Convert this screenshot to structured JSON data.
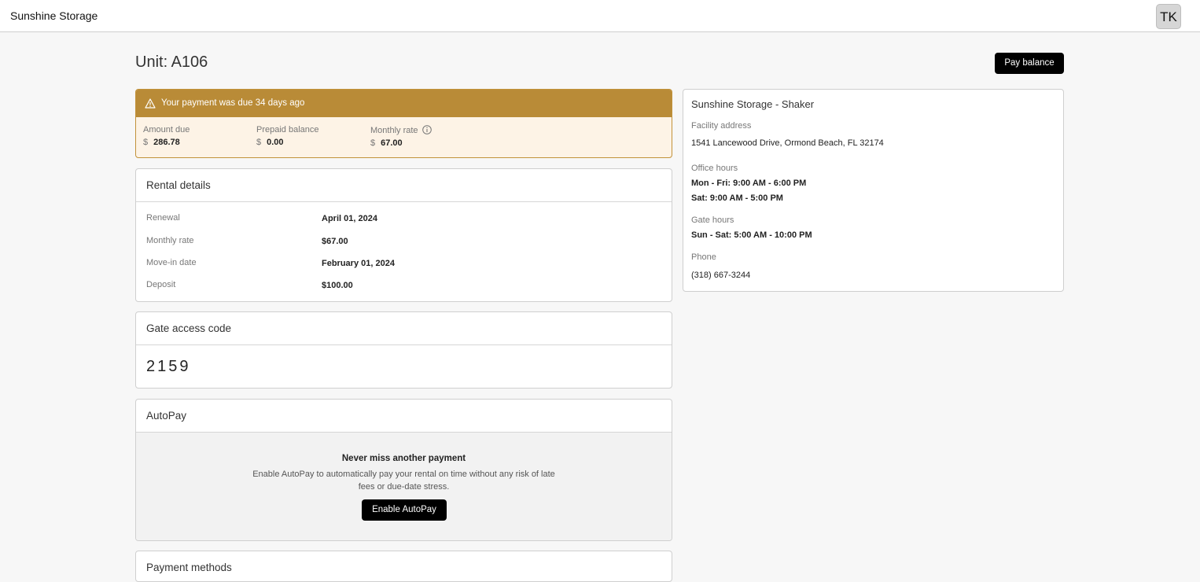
{
  "app": {
    "brand": "Sunshine Storage",
    "user_initials": "TK"
  },
  "page": {
    "title": "Unit: A106",
    "pay_button": "Pay balance"
  },
  "alert": {
    "message": "Your payment was due 34 days ago",
    "stats": [
      {
        "label": "Amount due",
        "currency": "$",
        "value": "286.78"
      },
      {
        "label": "Prepaid balance",
        "currency": "$",
        "value": "0.00"
      },
      {
        "label": "Monthly rate",
        "currency": "$",
        "value": "67.00"
      }
    ]
  },
  "rental": {
    "title": "Rental details",
    "rows": [
      {
        "label": "Renewal",
        "value": "April 01, 2024"
      },
      {
        "label": "Monthly rate",
        "value": "$67.00"
      },
      {
        "label": "Move-in date",
        "value": "February 01, 2024"
      },
      {
        "label": "Deposit",
        "value": "$100.00"
      }
    ]
  },
  "gate": {
    "title": "Gate access code",
    "code": "2159"
  },
  "autopay": {
    "title": "AutoPay",
    "headline": "Never miss another payment",
    "description": "Enable AutoPay to automatically pay your rental on time without any risk of late fees or due-date stress.",
    "button": "Enable AutoPay"
  },
  "next_section": {
    "title": "Payment methods"
  },
  "facility": {
    "name": "Sunshine Storage - Shaker",
    "address_label": "Facility address",
    "address": "1541 Lancewood Drive, Ormond Beach, FL 32174",
    "office_label": "Office hours",
    "office_hours": [
      "Mon - Fri: 9:00 AM - 6:00 PM",
      "Sat: 9:00 AM - 5:00 PM"
    ],
    "gate_label": "Gate hours",
    "gate_hours": "Sun - Sat: 5:00 AM - 10:00 PM",
    "phone_label": "Phone",
    "phone": "(318) 667-3244"
  },
  "colors": {
    "alert_bar": "#b98b37",
    "alert_bg": "#fdf3e6",
    "button": "#000000"
  }
}
